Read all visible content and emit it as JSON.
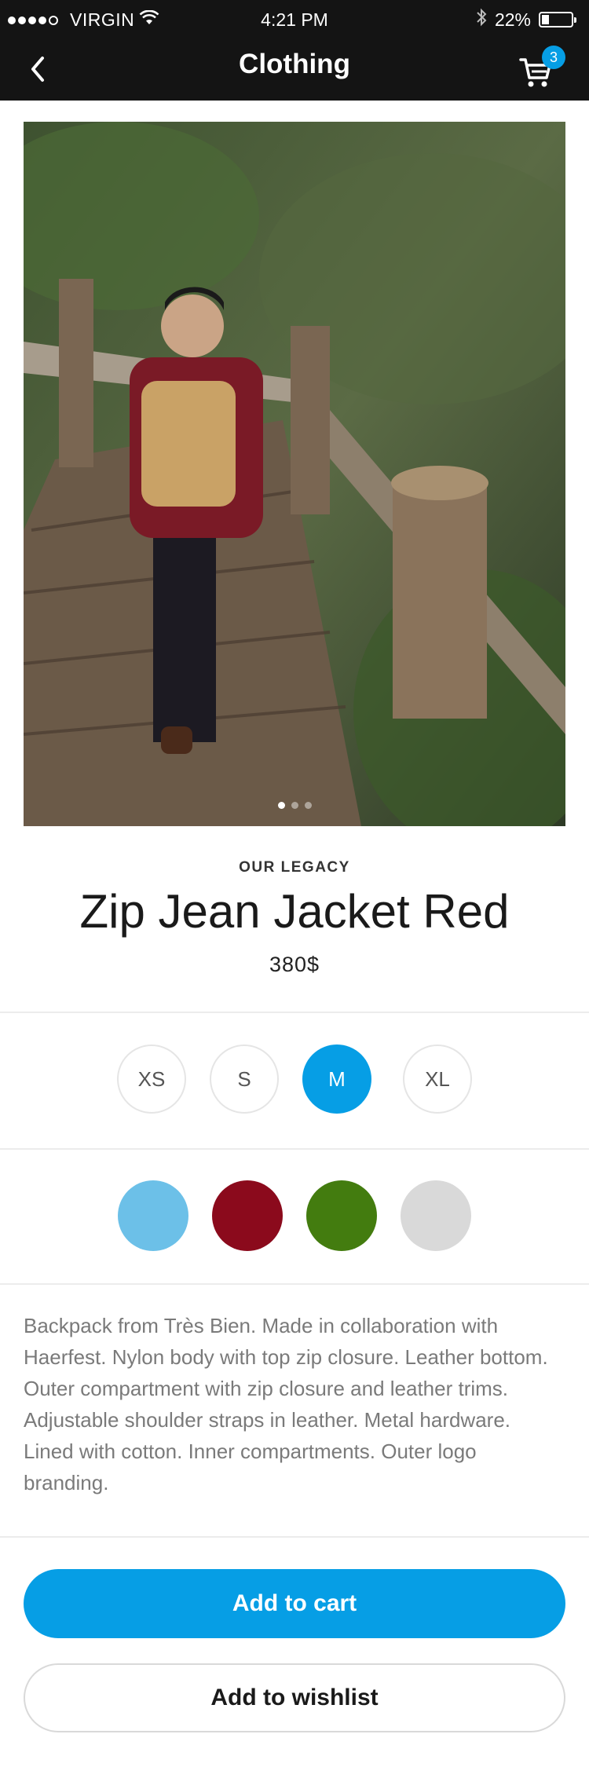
{
  "status_bar": {
    "carrier": "VIRGIN",
    "time": "4:21 PM",
    "battery": "22%"
  },
  "nav": {
    "title": "Clothing",
    "cart_count": "3"
  },
  "product": {
    "brand": "OUR LEGACY",
    "name": "Zip Jean Jacket Red",
    "price": "380$",
    "image_pages": 3,
    "image_active_page": 1
  },
  "sizes": [
    {
      "label": "XS",
      "selected": false
    },
    {
      "label": "S",
      "selected": false
    },
    {
      "label": "M",
      "selected": true
    },
    {
      "label": "XL",
      "selected": false
    }
  ],
  "colors": [
    {
      "name": "light-blue",
      "hex": "#6cc0e8"
    },
    {
      "name": "dark-red",
      "hex": "#8b0a1c"
    },
    {
      "name": "green",
      "hex": "#437c0f"
    },
    {
      "name": "light-gray",
      "hex": "#d9d9d9"
    }
  ],
  "description": "Backpack from Très Bien. Made in collaboration with Haerfest. Nylon body with top zip closure. Leather bottom. Outer compartment with zip closure and leather trims. Adjustable shoulder straps in leather. Metal hardware. Lined with cotton. Inner compartments. Outer logo branding.",
  "actions": {
    "add_to_cart": "Add to cart",
    "add_to_wishlist": "Add to wishlist"
  },
  "theme": {
    "accent": "#069ee5",
    "header_bg": "#141414"
  }
}
